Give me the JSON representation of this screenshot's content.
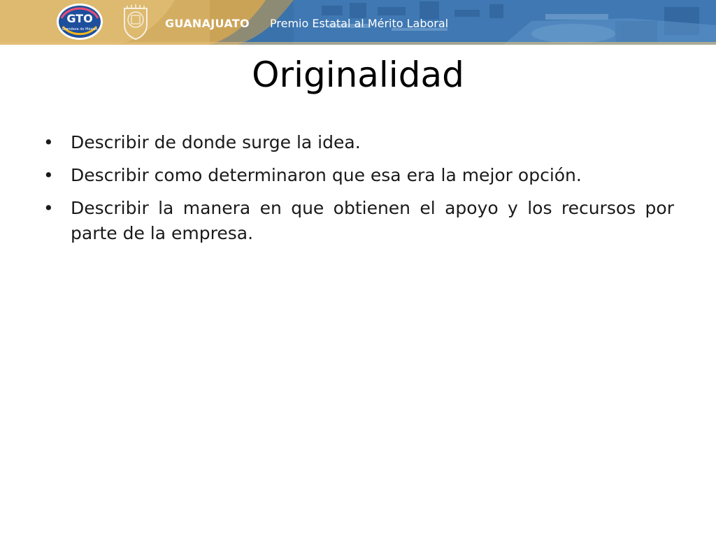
{
  "header": {
    "logo_text": "GTO",
    "logo_subtext": "Grandeza de México",
    "state_name": "GUANAJUATO",
    "award_name": "Premio Estatal al Mérito Laboral"
  },
  "slide": {
    "title": "Originalidad",
    "bullets": [
      "Describir de donde surge la idea.",
      "Describir como determinaron que esa era la mejor opción.",
      "Describir la manera en que obtienen el apoyo y los recursos por parte de la empresa."
    ]
  }
}
